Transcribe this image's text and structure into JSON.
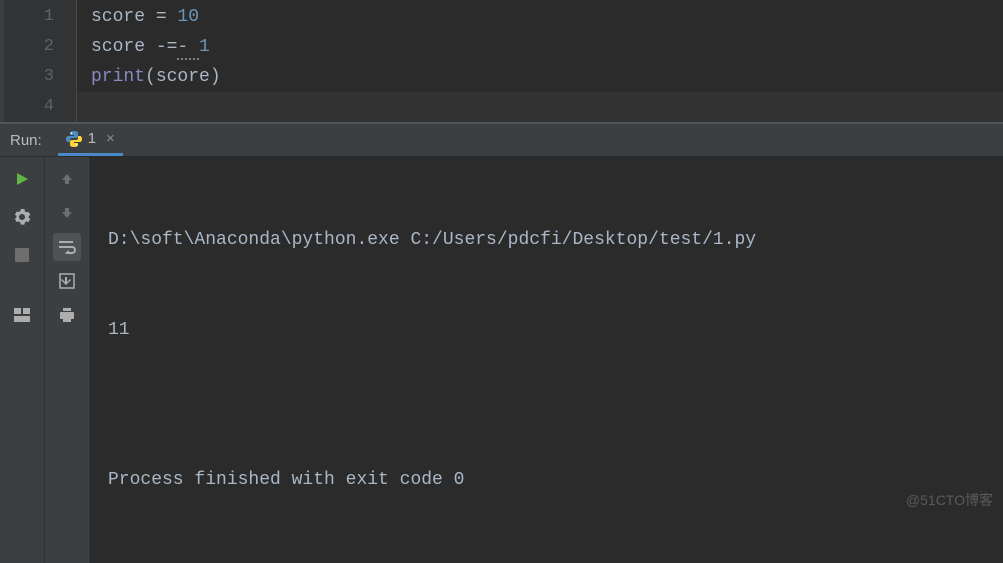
{
  "editor": {
    "lines": [
      {
        "num": "1",
        "tokens": [
          {
            "t": "score ",
            "c": "kw-var"
          },
          {
            "t": "= ",
            "c": "kw-op"
          },
          {
            "t": "10",
            "c": "kw-num"
          }
        ]
      },
      {
        "num": "2",
        "tokens": [
          {
            "t": "score ",
            "c": "kw-var"
          },
          {
            "t": "-=",
            "c": "kw-op"
          },
          {
            "t": "- ",
            "c": "kw-op",
            "squig": true
          },
          {
            "t": "1",
            "c": "kw-num"
          }
        ]
      },
      {
        "num": "3",
        "tokens": [
          {
            "t": "print",
            "c": "kw-func"
          },
          {
            "t": "(score)",
            "c": "kw-paren"
          }
        ]
      },
      {
        "num": "4",
        "tokens": [],
        "current": true
      }
    ]
  },
  "run": {
    "label": "Run:",
    "tab_name": "1",
    "tab_close": "×"
  },
  "console": {
    "cmd": "D:\\soft\\Anaconda\\python.exe C:/Users/pdcfi/Desktop/test/1.py",
    "output": "11",
    "blank": "",
    "exit": "Process finished with exit code 0"
  },
  "watermark": "@51CTO博客"
}
